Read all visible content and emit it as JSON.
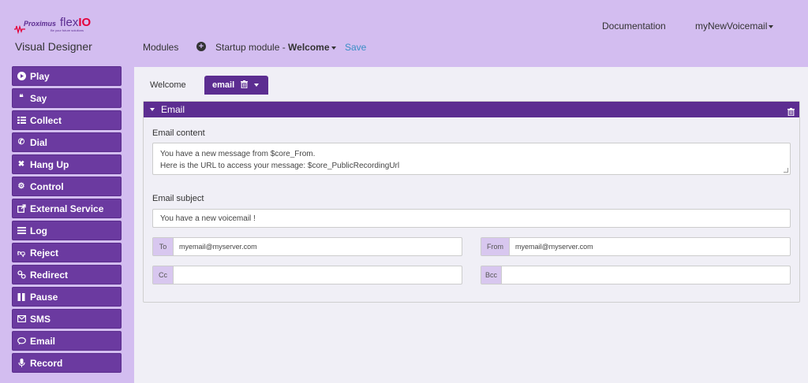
{
  "header": {
    "logo_brand": "Proximus",
    "logo_product": "flex",
    "logo_product_accent": "IO",
    "logo_tagline": "Be your future solutions",
    "app_title": "Visual Designer",
    "nav_documentation": "Documentation",
    "nav_user": "myNewVoicemail",
    "modules_label": "Modules",
    "add_icon": "plus-circle-icon",
    "startup_prefix": "Startup module - ",
    "startup_module": "Welcome",
    "save_label": "Save",
    "colors": {
      "header_bg": "#d3bdf0",
      "save_link": "#3a8ec6",
      "accent_red": "#e4003a"
    }
  },
  "sidebar": {
    "items": [
      {
        "label": "Play",
        "icon": "play-icon"
      },
      {
        "label": "Say",
        "icon": "quote-icon"
      },
      {
        "label": "Collect",
        "icon": "grid-icon"
      },
      {
        "label": "Dial",
        "icon": "phone-icon"
      },
      {
        "label": "Hang Up",
        "icon": "close-icon"
      },
      {
        "label": "Control",
        "icon": "cogs-icon"
      },
      {
        "label": "External Service",
        "icon": "external-link-icon"
      },
      {
        "label": "Log",
        "icon": "list-icon"
      },
      {
        "label": "Reject",
        "icon": "thumbs-down-icon"
      },
      {
        "label": "Redirect",
        "icon": "link-icon"
      },
      {
        "label": "Pause",
        "icon": "pause-icon"
      },
      {
        "label": "SMS",
        "icon": "envelope-icon"
      },
      {
        "label": "Email",
        "icon": "speech-bubble-icon"
      },
      {
        "label": "Record",
        "icon": "microphone-icon"
      }
    ],
    "colors": {
      "button_bg": "#6b3aa0"
    }
  },
  "main": {
    "tabs": {
      "welcome": "Welcome",
      "email": "email"
    },
    "panel": {
      "title": "Email",
      "content_label": "Email content",
      "content_line1": "You have a new message from $core_From.",
      "content_line2": "Here is the URL to access your message: $core_PublicRecordingUrl",
      "subject_label": "Email subject",
      "subject_value": "You have a new voicemail !",
      "to_label": "To",
      "to_value": "myemail@myserver.com",
      "from_label": "From",
      "from_value": "myemail@myserver.com",
      "cc_label": "Cc",
      "cc_value": "",
      "bcc_label": "Bcc",
      "bcc_value": ""
    },
    "colors": {
      "panel_header": "#5c2d91",
      "addon_bg": "#d8c7ef",
      "main_bg": "#f0eff6"
    }
  }
}
